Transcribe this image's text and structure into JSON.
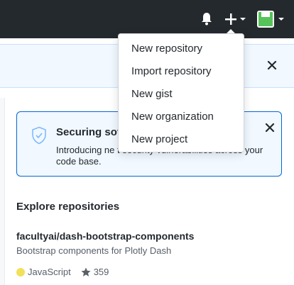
{
  "header": {
    "notifications_icon": "bell-icon",
    "create_icon": "plus-icon",
    "avatar_color": "#57c35b"
  },
  "create_menu": {
    "items": [
      {
        "label": "New repository"
      },
      {
        "label": "Import repository"
      },
      {
        "label": "New gist"
      },
      {
        "label": "New organization"
      },
      {
        "label": "New project"
      }
    ]
  },
  "security_card": {
    "title": "Securing sof",
    "body": "Introducing ne                                       t security vulnerabilities across your code base."
  },
  "explore": {
    "title": "Explore repositories",
    "repo": {
      "name": "facultyai/dash-bootstrap-components",
      "description": "Bootstrap components for Plotly Dash",
      "language": "JavaScript",
      "language_color": "#f1e05a",
      "stars": "359"
    }
  }
}
